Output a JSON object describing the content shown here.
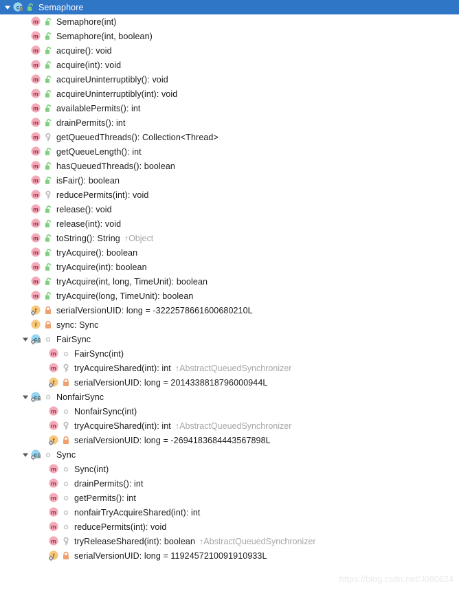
{
  "window": {
    "title": "Semaphore",
    "watermark": "https://blog.csdn.net/J080624"
  },
  "colors": {
    "selection_bg": "#2f76c7",
    "selection_fg": "#ffffff",
    "method_badge": "#f4a9b8",
    "field_badge": "#f7c77c",
    "class_badge": "#96d4f0",
    "lock_public": "#7ed07e",
    "lock_private": "#f0a070",
    "dot_package": "#c9c9c9",
    "key_protected": "#b8b8b8",
    "overridden_text": "#a6a6a6",
    "watermark": "#eaeaea"
  },
  "icon_legend": {
    "expanded": "triangle-down-icon",
    "class": "class-badge-icon",
    "method": "method-badge-icon",
    "method_final": "method-final-badge-icon",
    "field": "field-badge-icon",
    "field_static": "field-static-badge-icon",
    "class_static_private": "class-static-private-badge-icon",
    "public": "lock-public-icon",
    "private": "lock-private-icon",
    "protected": "key-protected-icon",
    "package": "dot-package-private-icon"
  },
  "tree": [
    {
      "depth": 0,
      "twisty": "expanded",
      "kind": "class",
      "modifier": "none",
      "access": "public",
      "label": "Semaphore",
      "overridden": "",
      "selected": true
    },
    {
      "depth": 1,
      "twisty": "none",
      "kind": "method",
      "modifier": "none",
      "access": "public",
      "label": "Semaphore(int)",
      "overridden": "",
      "selected": false
    },
    {
      "depth": 1,
      "twisty": "none",
      "kind": "method",
      "modifier": "none",
      "access": "public",
      "label": "Semaphore(int, boolean)",
      "overridden": "",
      "selected": false
    },
    {
      "depth": 1,
      "twisty": "none",
      "kind": "method",
      "modifier": "none",
      "access": "public",
      "label": "acquire(): void",
      "overridden": "",
      "selected": false
    },
    {
      "depth": 1,
      "twisty": "none",
      "kind": "method",
      "modifier": "none",
      "access": "public",
      "label": "acquire(int): void",
      "overridden": "",
      "selected": false
    },
    {
      "depth": 1,
      "twisty": "none",
      "kind": "method",
      "modifier": "none",
      "access": "public",
      "label": "acquireUninterruptibly(): void",
      "overridden": "",
      "selected": false
    },
    {
      "depth": 1,
      "twisty": "none",
      "kind": "method",
      "modifier": "none",
      "access": "public",
      "label": "acquireUninterruptibly(int): void",
      "overridden": "",
      "selected": false
    },
    {
      "depth": 1,
      "twisty": "none",
      "kind": "method",
      "modifier": "none",
      "access": "public",
      "label": "availablePermits(): int",
      "overridden": "",
      "selected": false
    },
    {
      "depth": 1,
      "twisty": "none",
      "kind": "method",
      "modifier": "none",
      "access": "public",
      "label": "drainPermits(): int",
      "overridden": "",
      "selected": false
    },
    {
      "depth": 1,
      "twisty": "none",
      "kind": "method",
      "modifier": "none",
      "access": "protected",
      "label": "getQueuedThreads(): Collection<Thread>",
      "overridden": "",
      "selected": false
    },
    {
      "depth": 1,
      "twisty": "none",
      "kind": "method",
      "modifier": "final",
      "access": "public",
      "label": "getQueueLength(): int",
      "overridden": "",
      "selected": false
    },
    {
      "depth": 1,
      "twisty": "none",
      "kind": "method",
      "modifier": "final",
      "access": "public",
      "label": "hasQueuedThreads(): boolean",
      "overridden": "",
      "selected": false
    },
    {
      "depth": 1,
      "twisty": "none",
      "kind": "method",
      "modifier": "none",
      "access": "public",
      "label": "isFair(): boolean",
      "overridden": "",
      "selected": false
    },
    {
      "depth": 1,
      "twisty": "none",
      "kind": "method",
      "modifier": "none",
      "access": "protected",
      "label": "reducePermits(int): void",
      "overridden": "",
      "selected": false
    },
    {
      "depth": 1,
      "twisty": "none",
      "kind": "method",
      "modifier": "none",
      "access": "public",
      "label": "release(): void",
      "overridden": "",
      "selected": false
    },
    {
      "depth": 1,
      "twisty": "none",
      "kind": "method",
      "modifier": "none",
      "access": "public",
      "label": "release(int): void",
      "overridden": "",
      "selected": false
    },
    {
      "depth": 1,
      "twisty": "none",
      "kind": "method",
      "modifier": "none",
      "access": "public",
      "label": "toString(): String",
      "overridden": "↑Object",
      "selected": false
    },
    {
      "depth": 1,
      "twisty": "none",
      "kind": "method",
      "modifier": "none",
      "access": "public",
      "label": "tryAcquire(): boolean",
      "overridden": "",
      "selected": false
    },
    {
      "depth": 1,
      "twisty": "none",
      "kind": "method",
      "modifier": "none",
      "access": "public",
      "label": "tryAcquire(int): boolean",
      "overridden": "",
      "selected": false
    },
    {
      "depth": 1,
      "twisty": "none",
      "kind": "method",
      "modifier": "none",
      "access": "public",
      "label": "tryAcquire(int, long, TimeUnit): boolean",
      "overridden": "",
      "selected": false
    },
    {
      "depth": 1,
      "twisty": "none",
      "kind": "method",
      "modifier": "none",
      "access": "public",
      "label": "tryAcquire(long, TimeUnit): boolean",
      "overridden": "",
      "selected": false
    },
    {
      "depth": 1,
      "twisty": "none",
      "kind": "field",
      "modifier": "static",
      "access": "private",
      "label": "serialVersionUID: long = -3222578661600680210L",
      "overridden": "",
      "selected": false
    },
    {
      "depth": 1,
      "twisty": "none",
      "kind": "field",
      "modifier": "final",
      "access": "private",
      "label": "sync: Sync",
      "overridden": "",
      "selected": false
    },
    {
      "depth": 1,
      "twisty": "expanded",
      "kind": "class",
      "modifier": "static",
      "access": "package",
      "label": "FairSync",
      "overridden": "",
      "selected": false
    },
    {
      "depth": 2,
      "twisty": "none",
      "kind": "method",
      "modifier": "none",
      "access": "package",
      "label": "FairSync(int)",
      "overridden": "",
      "selected": false
    },
    {
      "depth": 2,
      "twisty": "none",
      "kind": "method",
      "modifier": "none",
      "access": "protected",
      "label": "tryAcquireShared(int): int",
      "overridden": "↑AbstractQueuedSynchronizer",
      "selected": false
    },
    {
      "depth": 2,
      "twisty": "none",
      "kind": "field",
      "modifier": "static",
      "access": "private",
      "label": "serialVersionUID: long = 2014338818796000944L",
      "overridden": "",
      "selected": false
    },
    {
      "depth": 1,
      "twisty": "expanded",
      "kind": "class",
      "modifier": "static",
      "access": "package",
      "label": "NonfairSync",
      "overridden": "",
      "selected": false
    },
    {
      "depth": 2,
      "twisty": "none",
      "kind": "method",
      "modifier": "none",
      "access": "package",
      "label": "NonfairSync(int)",
      "overridden": "",
      "selected": false
    },
    {
      "depth": 2,
      "twisty": "none",
      "kind": "method",
      "modifier": "none",
      "access": "protected",
      "label": "tryAcquireShared(int): int",
      "overridden": "↑AbstractQueuedSynchronizer",
      "selected": false
    },
    {
      "depth": 2,
      "twisty": "none",
      "kind": "field",
      "modifier": "static",
      "access": "private",
      "label": "serialVersionUID: long = -2694183684443567898L",
      "overridden": "",
      "selected": false
    },
    {
      "depth": 1,
      "twisty": "expanded",
      "kind": "class",
      "modifier": "static",
      "access": "package",
      "label": "Sync",
      "overridden": "",
      "selected": false
    },
    {
      "depth": 2,
      "twisty": "none",
      "kind": "method",
      "modifier": "none",
      "access": "package",
      "label": "Sync(int)",
      "overridden": "",
      "selected": false
    },
    {
      "depth": 2,
      "twisty": "none",
      "kind": "method",
      "modifier": "final",
      "access": "package",
      "label": "drainPermits(): int",
      "overridden": "",
      "selected": false
    },
    {
      "depth": 2,
      "twisty": "none",
      "kind": "method",
      "modifier": "final",
      "access": "package",
      "label": "getPermits(): int",
      "overridden": "",
      "selected": false
    },
    {
      "depth": 2,
      "twisty": "none",
      "kind": "method",
      "modifier": "final",
      "access": "package",
      "label": "nonfairTryAcquireShared(int): int",
      "overridden": "",
      "selected": false
    },
    {
      "depth": 2,
      "twisty": "none",
      "kind": "method",
      "modifier": "final",
      "access": "package",
      "label": "reducePermits(int): void",
      "overridden": "",
      "selected": false
    },
    {
      "depth": 2,
      "twisty": "none",
      "kind": "method",
      "modifier": "final",
      "access": "protected",
      "label": "tryReleaseShared(int): boolean",
      "overridden": "↑AbstractQueuedSynchronizer",
      "selected": false
    },
    {
      "depth": 2,
      "twisty": "none",
      "kind": "field",
      "modifier": "static",
      "access": "private",
      "label": "serialVersionUID: long = 1192457210091910933L",
      "overridden": "",
      "selected": false
    }
  ]
}
